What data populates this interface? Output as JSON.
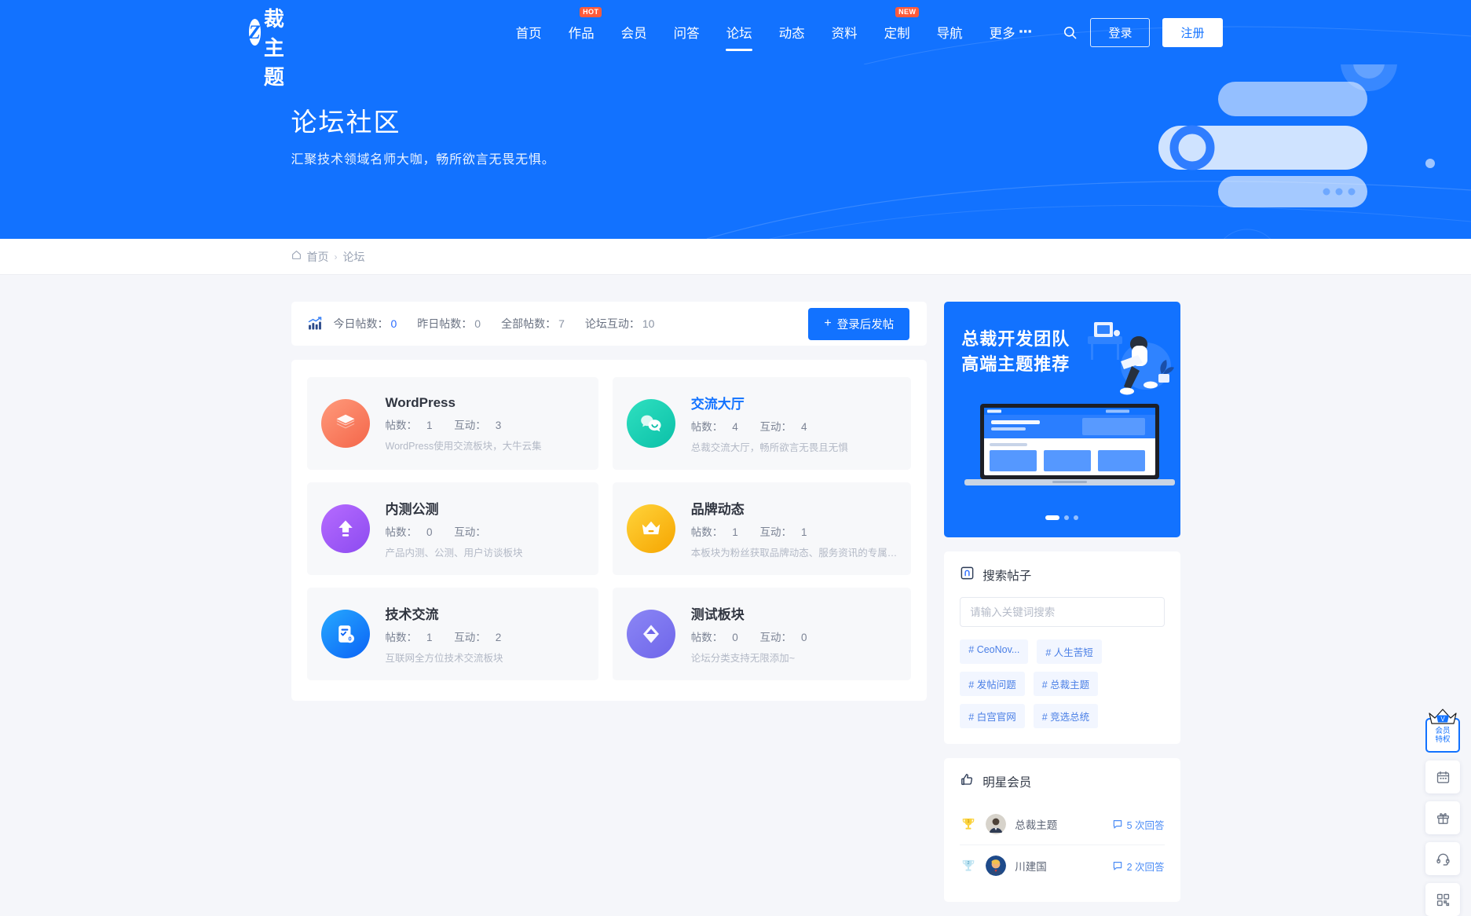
{
  "brand": {
    "logo_text": "总裁主题",
    "logo_mark": "Z"
  },
  "nav": {
    "items": [
      {
        "label": "首页",
        "badge": "",
        "active": false
      },
      {
        "label": "作品",
        "badge": "HOT",
        "active": false
      },
      {
        "label": "会员",
        "badge": "",
        "active": false
      },
      {
        "label": "问答",
        "badge": "",
        "active": false
      },
      {
        "label": "论坛",
        "badge": "",
        "active": true
      },
      {
        "label": "动态",
        "badge": "",
        "active": false
      },
      {
        "label": "资料",
        "badge": "",
        "active": false
      },
      {
        "label": "定制",
        "badge": "NEW",
        "active": false
      },
      {
        "label": "导航",
        "badge": "",
        "active": false
      },
      {
        "label": "更多",
        "badge": "",
        "active": false
      }
    ],
    "search_icon": "search-icon",
    "login_label": "登录",
    "register_label": "注册"
  },
  "hero": {
    "title": "论坛社区",
    "subtitle": "汇聚技术领域名师大咖，畅所欲言无畏无惧。"
  },
  "breadcrumb": {
    "home_icon": "home-icon",
    "home": "首页",
    "sep": "›",
    "current": "论坛"
  },
  "stats": {
    "icon": "chart-icon",
    "items": [
      {
        "label": "今日帖数：",
        "value": "0",
        "highlight": true
      },
      {
        "label": "昨日帖数：",
        "value": "0",
        "highlight": false
      },
      {
        "label": "全部帖数：",
        "value": "7",
        "highlight": false
      },
      {
        "label": "论坛互动：",
        "value": "10",
        "highlight": false
      }
    ],
    "post_button": "登录后发帖",
    "post_plus": "+"
  },
  "forums": [
    {
      "title": "WordPress",
      "title_blue": false,
      "posts_label": "帖数：",
      "posts": "1",
      "inter_label": "互动：",
      "inter": "3",
      "desc": "WordPress使用交流板块，大牛云集",
      "icon": "layers-icon",
      "c1": "#ff9a7b",
      "c2": "#f4664a"
    },
    {
      "title": "交流大厅",
      "title_blue": true,
      "posts_label": "帖数：",
      "posts": "4",
      "inter_label": "互动：",
      "inter": "4",
      "desc": "总裁交流大厅，畅所欲言无畏且无惧",
      "icon": "chat-icon",
      "c1": "#2fe0c0",
      "c2": "#0bc0a8"
    },
    {
      "title": "内测公测",
      "title_blue": false,
      "posts_label": "帖数：",
      "posts": "0",
      "inter_label": "互动：",
      "inter": "",
      "desc": "产品内测、公测、用户访谈板块",
      "icon": "upload-icon",
      "c1": "#b66bff",
      "c2": "#8c4bf0"
    },
    {
      "title": "品牌动态",
      "title_blue": false,
      "posts_label": "帖数：",
      "posts": "1",
      "inter_label": "互动：",
      "inter": "1",
      "desc": "本板块为粉丝获取品牌动态、服务资讯的专属…",
      "icon": "crown-icon",
      "c1": "#ffd43b",
      "c2": "#f6a500"
    },
    {
      "title": "技术交流",
      "title_blue": false,
      "posts_label": "帖数：",
      "posts": "1",
      "inter_label": "互动：",
      "inter": "2",
      "desc": "互联网全方位技术交流板块",
      "icon": "doc-icon",
      "c1": "#26a9ff",
      "c2": "#0b63f6"
    },
    {
      "title": "测试板块",
      "title_blue": false,
      "posts_label": "帖数：",
      "posts": "0",
      "inter_label": "互动：",
      "inter": "0",
      "desc": "论坛分类支持无限添加~",
      "icon": "gem-icon",
      "c1": "#8b86f5",
      "c2": "#6f66ea"
    }
  ],
  "ad": {
    "line1": "总裁开发团队",
    "line2": "高端主题推荐",
    "dots": 3,
    "active_dot": 0
  },
  "search_panel": {
    "icon": "search-post-icon",
    "title": "搜索帖子",
    "placeholder": "请输入关键词搜索",
    "value": "",
    "tags": [
      "# CeoNov...",
      "# 人生苦短",
      "# 发帖问题",
      "# 总裁主题",
      "# 白宫官网",
      "# 竞选总统"
    ]
  },
  "stars_panel": {
    "icon": "thumbs-up-icon",
    "title": "明星会员",
    "rows": [
      {
        "rank": "1",
        "name": "总裁主题",
        "answers": "5 次回答",
        "rank_color": "#f5c518"
      },
      {
        "rank": "2",
        "name": "川建国",
        "answers": "2 次回答",
        "rank_color": "#9fd8ea"
      }
    ]
  },
  "rail": {
    "vip_line1": "会员",
    "vip_line2": "特权",
    "buttons": [
      "calendar-icon",
      "gift-icon",
      "headset-icon",
      "qrcode-icon"
    ]
  },
  "colors": {
    "brand": "#1272ff",
    "accent": "#2b6cff",
    "badge": "#ff5b3a",
    "bg": "#f5f6fa"
  }
}
